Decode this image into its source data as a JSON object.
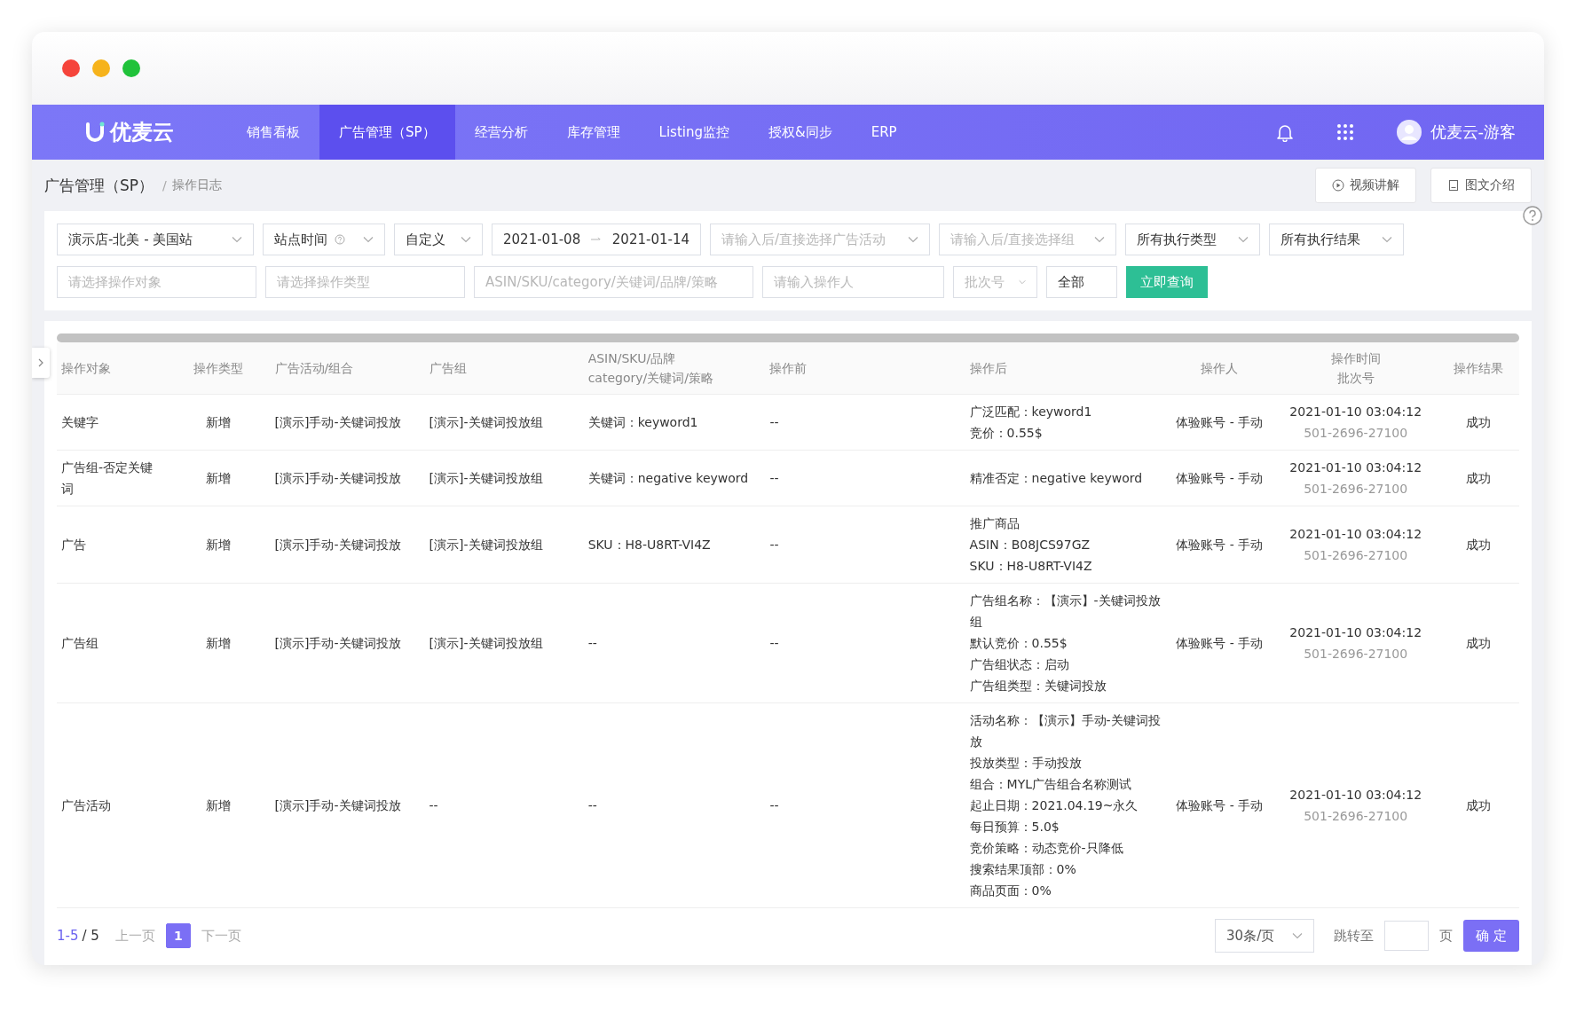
{
  "brand": {
    "name": "优麦云"
  },
  "nav": [
    {
      "label": "销售看板",
      "selected": false
    },
    {
      "label": "广告管理（SP）",
      "selected": true
    },
    {
      "label": "经营分析",
      "selected": false
    },
    {
      "label": "库存管理",
      "selected": false
    },
    {
      "label": "Listing监控",
      "selected": false
    },
    {
      "label": "授权&同步",
      "selected": false
    },
    {
      "label": "ERP",
      "selected": false
    }
  ],
  "user": {
    "name": "优麦云-游客"
  },
  "breadcrumb": {
    "title": "广告管理（SP）",
    "separator": "/",
    "current": "操作日志"
  },
  "header_buttons": [
    {
      "kind": "video",
      "label": "视频讲解"
    },
    {
      "kind": "doc",
      "label": "图文介绍"
    }
  ],
  "filters_row_1": [
    {
      "kind": "select",
      "value": "演示店-北美 - 美国站"
    },
    {
      "kind": "select-help",
      "value": "站点时间"
    },
    {
      "kind": "select",
      "value": "自定义"
    },
    {
      "kind": "range",
      "from": "2021-01-08",
      "to": "2021-01-14"
    },
    {
      "kind": "select",
      "placeholder": "请输入后/直接选择广告活动"
    },
    {
      "kind": "select",
      "placeholder": "请输入后/直接选择组"
    },
    {
      "kind": "select",
      "value": "所有执行类型"
    },
    {
      "kind": "select",
      "value": "所有执行结果"
    }
  ],
  "filters_row_2": [
    {
      "kind": "input",
      "placeholder": "请选择操作对象"
    },
    {
      "kind": "input",
      "placeholder": "请选择操作类型"
    },
    {
      "kind": "input",
      "placeholder": "ASIN/SKU/category/关键词/品牌/策略"
    },
    {
      "kind": "input",
      "placeholder": "请输入操作人"
    },
    {
      "kind": "select",
      "placeholder": "批次号"
    },
    {
      "kind": "input",
      "value": "全部"
    },
    {
      "kind": "button",
      "label": "立即查询"
    }
  ],
  "table": {
    "columns": [
      [
        "操作对象"
      ],
      [
        "操作类型"
      ],
      [
        "广告活动/组合"
      ],
      [
        "广告组"
      ],
      [
        "ASIN/SKU/品牌",
        "category/关键词/策略"
      ],
      [
        "操作前"
      ],
      [
        "操作后"
      ],
      [
        "操作人"
      ],
      [
        "操作时间",
        "批次号"
      ],
      [
        "操作结果"
      ]
    ],
    "rows": [
      {
        "object": "关键字",
        "type": "新增",
        "campaign": "[演示]手动-关键词投放",
        "group": "[演示]-关键词投放组",
        "target": "关键词：keyword1",
        "before": "--",
        "after": [
          "广泛匹配：keyword1",
          "竞价：0.55$"
        ],
        "operator": "体验账号 - 手动",
        "time": "2021-01-10 03:04:12",
        "batch": "501-2696-27100",
        "result": "成功"
      },
      {
        "object": "广告组-否定关键词",
        "type": "新增",
        "campaign": "[演示]手动-关键词投放",
        "group": "[演示]-关键词投放组",
        "target": "关键词：negative keyword",
        "before": "--",
        "after": [
          "精准否定：negative keyword"
        ],
        "operator": "体验账号 - 手动",
        "time": "2021-01-10 03:04:12",
        "batch": "501-2696-27100",
        "result": "成功"
      },
      {
        "object": "广告",
        "type": "新增",
        "campaign": "[演示]手动-关键词投放",
        "group": "[演示]-关键词投放组",
        "target": "SKU：H8-U8RT-VI4Z",
        "before": "--",
        "after": [
          "推广商品",
          "ASIN：B08JCS97GZ",
          "SKU：H8-U8RT-VI4Z"
        ],
        "operator": "体验账号 - 手动",
        "time": "2021-01-10 03:04:12",
        "batch": "501-2696-27100",
        "result": "成功"
      },
      {
        "object": "广告组",
        "type": "新增",
        "campaign": "[演示]手动-关键词投放",
        "group": "[演示]-关键词投放组",
        "target": "--",
        "before": "--",
        "after": [
          "广告组名称：【演示】-关键词投放组",
          "默认竞价：0.55$",
          "广告组状态：启动",
          "广告组类型：关键词投放"
        ],
        "operator": "体验账号 - 手动",
        "time": "2021-01-10 03:04:12",
        "batch": "501-2696-27100",
        "result": "成功"
      },
      {
        "object": "广告活动",
        "type": "新增",
        "campaign": "[演示]手动-关键词投放",
        "group": "--",
        "target": "--",
        "before": "--",
        "after": [
          "活动名称：【演示】手动-关键词投放",
          "投放类型：手动投放",
          "组合：MYL广告组合名称测试",
          "起止日期：2021.04.19~永久",
          "每日预算：5.0$",
          "竞价策略：动态竞价-只降低",
          "搜索结果顶部：0%",
          "商品页面：0%"
        ],
        "operator": "体验账号 - 手动",
        "time": "2021-01-10 03:04:12",
        "batch": "501-2696-27100",
        "result": "成功"
      }
    ]
  },
  "pagination": {
    "range": "1-5",
    "total": "/ 5",
    "prev": "上一页",
    "pages": [
      {
        "label": "1",
        "selected": true
      }
    ],
    "next": "下一页",
    "page_size": "30条/页",
    "jump_label": "跳转至",
    "jump_unit": "页",
    "confirm": "确 定"
  }
}
